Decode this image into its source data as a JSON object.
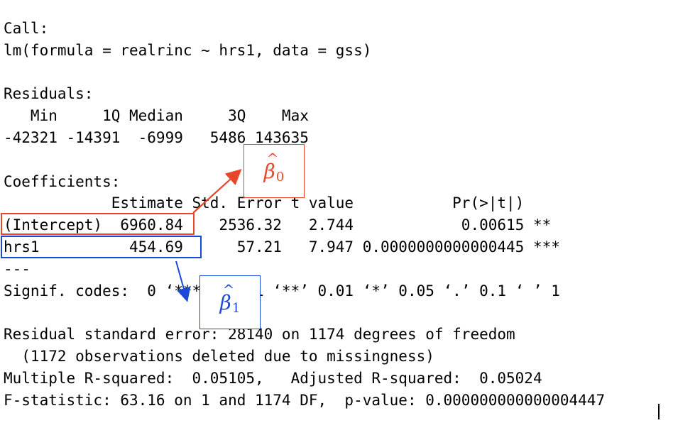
{
  "output_lines": [
    "Call:",
    "lm(formula = realrinc ~ hrs1, data = gss)",
    "",
    "Residuals:",
    "   Min     1Q Median     3Q    Max ",
    "-42321 -14391  -6999   5486 143635 ",
    "",
    "Coefficients:",
    "            Estimate Std. Error t value           Pr(>|t|)    ",
    "(Intercept)  6960.84    2536.32   2.744            0.00615 ** ",
    "hrs1          454.69      57.21   7.947 0.0000000000000445 ***",
    "---",
    "Signif. codes:  0 ‘***’ 0.001 ‘**’ 0.01 ‘*’ 0.05 ‘.’ 0.1 ‘ ’ 1",
    "",
    "Residual standard error: 28140 on 1174 degrees of freedom",
    "  (1172 observations deleted due to missingness)",
    "Multiple R-squared:  0.05105,\tAdjusted R-squared:  0.05024 ",
    "F-statistic: 63.16 on 1 and 1174 DF,  p-value: 0.000000000000004447"
  ],
  "annotations": {
    "beta0": {
      "symbol": "β",
      "subscript": "0",
      "color": "#e8462a"
    },
    "beta1": {
      "symbol": "β",
      "subscript": "1",
      "color": "#1a49d6"
    }
  }
}
